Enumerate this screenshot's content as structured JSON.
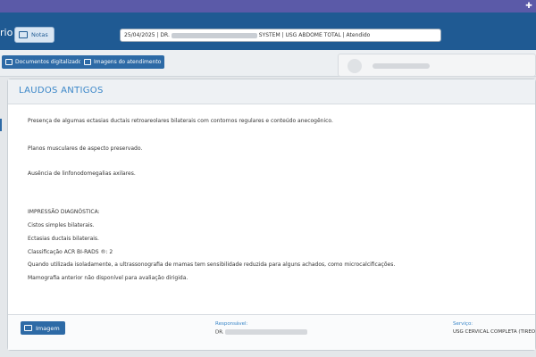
{
  "header": {
    "left_text": "rio",
    "notes_label": "Notas",
    "info_prefix": "25/04/2025 | DR. ",
    "info_suffix": " SYSTEM | USG ABDOME TOTAL | Atendido"
  },
  "toolbar": {
    "docs_label": "Documentos digitalizados",
    "attendance_label": "Imagens do atendimento"
  },
  "panel": {
    "title": "LAUDOS ANTIGOS",
    "report_lines": [
      "Presença de algumas ectasias ductais retroareolares bilaterais com contornos regulares e conteúdo anecogênico.",
      "Planos musculares de aspecto preservado.",
      "Ausência de linfonodomegalias axilares.",
      "IMPRESSÃO DIAGNÓSTICA:",
      "Cistos simples bilaterais.",
      "Ectasias ductais bilaterais.",
      "Classificação ACR BI-RADS ®: 2",
      "Quando utilizada isoladamente, a ultrassonografia de mamas tem sensibilidade reduzida para alguns achados, como microcalcificações.",
      "Mamografia anterior não disponível para avaliação dirigida."
    ]
  },
  "footer": {
    "image_label": "Imagem",
    "responsible_label": "Responsável:",
    "responsible_value": "DR. ",
    "service_label": "Serviço:",
    "service_value": "USG CERVICAL COMPLETA (TIREO"
  },
  "icons": {
    "top_right": "puzzle-icon",
    "notes": "chat-icon",
    "docs": "document-icon",
    "attendance": "image-icon",
    "image": "image-icon"
  }
}
